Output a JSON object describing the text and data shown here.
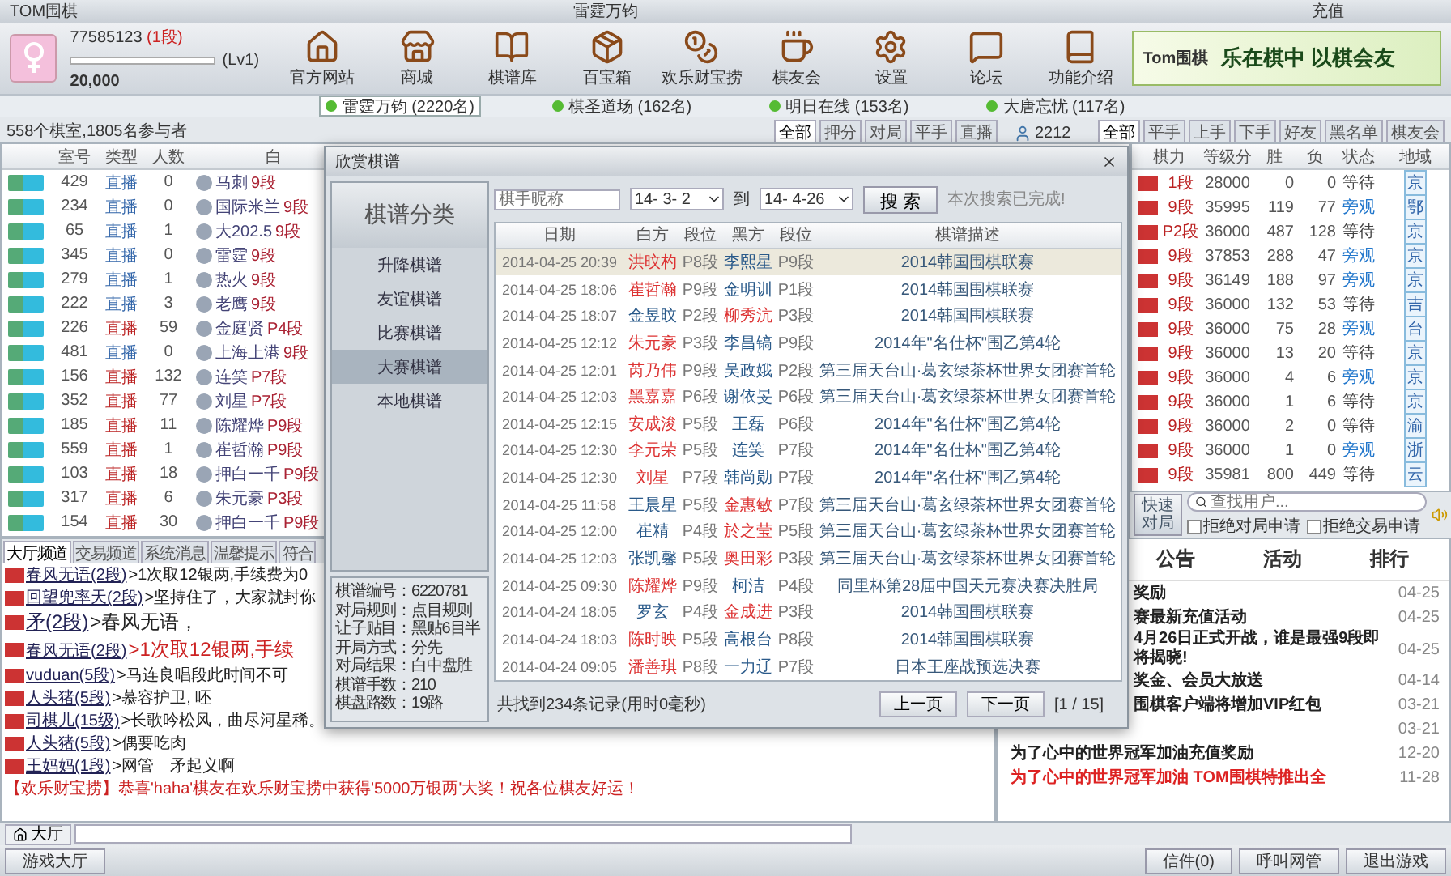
{
  "window": {
    "title": "TOM围棋",
    "server_title": "雷霆万钧",
    "recharge": "充值"
  },
  "user": {
    "id": "77585123",
    "rank": "(1段)",
    "level_label": "(Lv1)",
    "coins": "20,000",
    "level": 0.0
  },
  "toolbar": [
    "官方网站",
    "商城",
    "棋谱库",
    "百宝箱",
    "欢乐财宝捞",
    "棋友会",
    "设置",
    "论坛",
    "功能介绍"
  ],
  "banner": {
    "text": "乐在棋中 以棋会友",
    "logo": "Tom围棋"
  },
  "servers": [
    {
      "label": "雷霆万钧 (2220名)",
      "selected": true
    },
    {
      "label": "棋圣道场 (162名)",
      "selected": false
    },
    {
      "label": "明日在线 (153名)",
      "selected": false
    },
    {
      "label": "大唐忘忧 (117名)",
      "selected": false
    }
  ],
  "rooms_summary": "558个棋室,1805名参与者",
  "room_filters": [
    {
      "label": "全部",
      "selected": true
    },
    {
      "label": "押分",
      "selected": false
    },
    {
      "label": "对局",
      "selected": false
    },
    {
      "label": "平手",
      "selected": false
    },
    {
      "label": "直播",
      "selected": false
    }
  ],
  "online_count": "2212",
  "player_filters": [
    {
      "label": "全部",
      "selected": true
    },
    {
      "label": "平手",
      "selected": false
    },
    {
      "label": "上手",
      "selected": false
    },
    {
      "label": "下手",
      "selected": false
    },
    {
      "label": "好友",
      "selected": false
    },
    {
      "label": "黑名单",
      "selected": false
    },
    {
      "label": "棋友会",
      "selected": false
    }
  ],
  "rooms": {
    "columns": [
      "室号",
      "类型",
      "人数",
      "白"
    ],
    "rows": [
      {
        "room": "429",
        "type": "直播",
        "count": "0",
        "white": "马刺",
        "rank": "9段",
        "hot": false
      },
      {
        "room": "234",
        "type": "直播",
        "count": "0",
        "white": "国际米兰",
        "rank": "9段",
        "hot": false
      },
      {
        "room": "65",
        "type": "直播",
        "count": "1",
        "white": "大202.5",
        "rank": "9段",
        "hot": false
      },
      {
        "room": "345",
        "type": "直播",
        "count": "0",
        "white": "雷霆",
        "rank": "9段",
        "hot": false
      },
      {
        "room": "279",
        "type": "直播",
        "count": "1",
        "white": "热火",
        "rank": "9段",
        "hot": false
      },
      {
        "room": "222",
        "type": "直播",
        "count": "3",
        "white": "老鹰",
        "rank": "9段",
        "hot": false
      },
      {
        "room": "226",
        "type": "直播",
        "count": "59",
        "white": "金庭贤",
        "rank": "P4段",
        "hot": true
      },
      {
        "room": "481",
        "type": "直播",
        "count": "0",
        "white": "上海上港",
        "rank": "9段",
        "hot": false
      },
      {
        "room": "156",
        "type": "直播",
        "count": "132",
        "white": "连笑",
        "rank": "P7段",
        "hot": true
      },
      {
        "room": "352",
        "type": "直播",
        "count": "77",
        "white": "刘星",
        "rank": "P7段",
        "hot": true
      },
      {
        "room": "185",
        "type": "直播",
        "count": "11",
        "white": "陈耀烨",
        "rank": "P9段",
        "hot": true
      },
      {
        "room": "559",
        "type": "直播",
        "count": "1",
        "white": "崔哲瀚",
        "rank": "P9段",
        "hot": true
      },
      {
        "room": "103",
        "type": "直播",
        "count": "18",
        "white": "押白一千",
        "rank": "P9段",
        "hot": true
      },
      {
        "room": "317",
        "type": "直播",
        "count": "6",
        "white": "朱元豪",
        "rank": "P3段",
        "hot": true
      },
      {
        "room": "154",
        "type": "直播",
        "count": "30",
        "white": "押白一千",
        "rank": "P9段",
        "hot": true
      }
    ]
  },
  "players": {
    "columns": [
      "棋力",
      "等级分",
      "胜",
      "负",
      "状态",
      "地域"
    ],
    "rows": [
      {
        "rank": "1段",
        "score": "28000",
        "wins": "0",
        "losses": "0",
        "status": "等待",
        "watching": false,
        "region": "京"
      },
      {
        "rank": "9段",
        "score": "35995",
        "wins": "119",
        "losses": "77",
        "status": "旁观",
        "watching": true,
        "region": "鄂"
      },
      {
        "rank": "P2段",
        "score": "36000",
        "wins": "487",
        "losses": "128",
        "status": "等待",
        "watching": false,
        "region": "京"
      },
      {
        "rank": "9段",
        "score": "37853",
        "wins": "288",
        "losses": "47",
        "status": "旁观",
        "watching": true,
        "region": "京"
      },
      {
        "rank": "9段",
        "score": "36149",
        "wins": "188",
        "losses": "97",
        "status": "旁观",
        "watching": true,
        "region": "京"
      },
      {
        "rank": "9段",
        "score": "36000",
        "wins": "132",
        "losses": "53",
        "status": "等待",
        "watching": false,
        "region": "吉"
      },
      {
        "rank": "9段",
        "score": "36000",
        "wins": "75",
        "losses": "28",
        "status": "旁观",
        "watching": true,
        "region": "台"
      },
      {
        "rank": "9段",
        "score": "36000",
        "wins": "13",
        "losses": "20",
        "status": "等待",
        "watching": false,
        "region": "京"
      },
      {
        "rank": "9段",
        "score": "36000",
        "wins": "4",
        "losses": "6",
        "status": "旁观",
        "watching": true,
        "region": "京"
      },
      {
        "rank": "9段",
        "score": "36000",
        "wins": "1",
        "losses": "6",
        "status": "等待",
        "watching": false,
        "region": "京"
      },
      {
        "rank": "9段",
        "score": "36000",
        "wins": "2",
        "losses": "0",
        "status": "等待",
        "watching": false,
        "region": "渝"
      },
      {
        "rank": "9段",
        "score": "36000",
        "wins": "1",
        "losses": "0",
        "status": "旁观",
        "watching": true,
        "region": "浙"
      },
      {
        "rank": "9段",
        "score": "35981",
        "wins": "800",
        "losses": "449",
        "status": "等待",
        "watching": false,
        "region": "云"
      }
    ]
  },
  "quick_match": "快速对局",
  "user_search": {
    "placeholder": "查找用户..."
  },
  "options": [
    {
      "label": "拒绝对局申请",
      "checked": false
    },
    {
      "label": "拒绝交易申请",
      "checked": false
    }
  ],
  "chat_tabs": [
    {
      "label": "大厅频道",
      "selected": true
    },
    {
      "label": "交易频道",
      "selected": false
    },
    {
      "label": "系统消息",
      "selected": false
    },
    {
      "label": "温馨提示",
      "selected": false
    },
    {
      "label": "符合",
      "selected": false
    }
  ],
  "messages": [
    {
      "kind": "normal",
      "sender": "春风无语(2段)",
      "text": ">1次取12银两,手续费为0"
    },
    {
      "kind": "normal",
      "sender": "回望兜率天(2段)",
      "text": ">坚持住了，大家就封你"
    },
    {
      "kind": "big",
      "sender": "矛(2段)",
      "text": ">春风无语，"
    },
    {
      "kind": "bigred",
      "sender": "春风无语(2段)",
      "text": ">1次取12银两,手续"
    },
    {
      "kind": "normal",
      "sender": "vuduan(5段)",
      "text": ">马连良唱段此时间不可"
    },
    {
      "kind": "normal",
      "sender": "人头猪(5段)",
      "text": ">慕容护卫, 呸"
    },
    {
      "kind": "normal",
      "sender": "司棋儿(15级)",
      "text": ">长歌吟松风，曲尽河星稀。"
    },
    {
      "kind": "normal",
      "sender": "人头猪(5段)",
      "text": ">偶要吃肉"
    },
    {
      "kind": "normal",
      "sender": "王妈妈(1段)",
      "text": ">网管　矛起义啊"
    },
    {
      "kind": "system",
      "text": "【欢乐财宝捞】恭喜'haha'棋友在欢乐财宝捞中获得'5000万银两'大奖！祝各位棋友好运！"
    }
  ],
  "news_tabs": [
    {
      "label": "公告",
      "selected": false
    },
    {
      "label": "活动",
      "selected": false
    },
    {
      "label": "排行",
      "selected": false
    }
  ],
  "news": [
    {
      "title": "奖励",
      "date": "04-25",
      "highlight": false,
      "covered": true
    },
    {
      "title": "赛最新充值活动",
      "date": "04-25",
      "highlight": false,
      "covered": true
    },
    {
      "title": "4月26日正式开战，谁是最强9段即将揭晓!",
      "date": "04-25",
      "highlight": false,
      "covered": true
    },
    {
      "title": "奖金、会员大放送",
      "date": "04-14",
      "highlight": false,
      "covered": true
    },
    {
      "title": "围棋客户端将增加VIP红包",
      "date": "03-21",
      "highlight": false,
      "covered": true
    },
    {
      "date": "03-21"
    },
    {
      "title": "为了心中的世界冠军加油充值奖励",
      "date": "12-20",
      "highlight": false,
      "covered": false
    },
    {
      "title": "为了心中的世界冠军加油  TOM围棋特推出全",
      "date": "11-28",
      "highlight": true,
      "covered": false
    }
  ],
  "chat_input": {
    "channel": "大厅"
  },
  "status_bar": {
    "tab": "游戏大厅",
    "buttons": [
      "信件(0)",
      "呼叫网管",
      "退出游戏"
    ]
  },
  "dialog": {
    "title": "欣赏棋谱",
    "category_title": "棋谱分类",
    "categories": [
      {
        "label": "升降棋谱",
        "selected": false
      },
      {
        "label": "友谊棋谱",
        "selected": false
      },
      {
        "label": "比赛棋谱",
        "selected": false
      },
      {
        "label": "大赛棋谱",
        "selected": true
      },
      {
        "label": "本地棋谱",
        "selected": false
      }
    ],
    "info": [
      "棋谱编号：6220781",
      "对局规则：点目规则",
      "让子贴目：黑贴6目半",
      "开局方式：分先",
      "对局结果：白中盘胜",
      "棋谱手数：210",
      "棋盘路数：19路"
    ],
    "search": {
      "placeholder": "棋手昵称",
      "from": "14- 3- 2",
      "to_label": "到",
      "to": "14- 4-26",
      "button": "搜 索",
      "status": "本次搜索已完成!"
    },
    "columns": [
      "日期",
      "白方",
      "段位",
      "黑方",
      "段位",
      "棋谱描述"
    ],
    "rows": [
      {
        "date": "2014-04-25 20:39",
        "white": "洪旼杓",
        "wrank": "P8段",
        "black": "李熙星",
        "brank": "P9段",
        "desc": "2014韩国围棋联赛",
        "white_won": true,
        "selected": true
      },
      {
        "date": "2014-04-25 18:06",
        "white": "崔哲瀚",
        "wrank": "P9段",
        "black": "金明训",
        "brank": "P1段",
        "desc": "2014韩国围棋联赛",
        "white_won": true,
        "selected": false
      },
      {
        "date": "2014-04-25 18:07",
        "white": "金昱旼",
        "wrank": "P2段",
        "black": "柳秀沆",
        "brank": "P3段",
        "desc": "2014韩国围棋联赛",
        "white_won": false,
        "selected": false
      },
      {
        "date": "2014-04-25 12:12",
        "white": "朱元豪",
        "wrank": "P3段",
        "black": "李昌镐",
        "brank": "P9段",
        "desc": "2014年\"名仕杯\"围乙第4轮",
        "white_won": true,
        "selected": false
      },
      {
        "date": "2014-04-25 12:01",
        "white": "芮乃伟",
        "wrank": "P9段",
        "black": "吴政娥",
        "brank": "P2段",
        "desc": "第三届天台山·葛玄绿茶杯世界女团赛首轮",
        "white_won": true,
        "selected": false
      },
      {
        "date": "2014-04-25 12:03",
        "white": "黑嘉嘉",
        "wrank": "P6段",
        "black": "谢依旻",
        "brank": "P6段",
        "desc": "第三届天台山·葛玄绿茶杯世界女团赛首轮",
        "white_won": true,
        "selected": false
      },
      {
        "date": "2014-04-25 12:15",
        "white": "安成浚",
        "wrank": "P5段",
        "black": "王磊",
        "brank": "P6段",
        "desc": "2014年\"名仕杯\"围乙第4轮",
        "white_won": true,
        "selected": false
      },
      {
        "date": "2014-04-25 12:30",
        "white": "李元荣",
        "wrank": "P5段",
        "black": "连笑",
        "brank": "P7段",
        "desc": "2014年\"名仕杯\"围乙第4轮",
        "white_won": true,
        "selected": false
      },
      {
        "date": "2014-04-25 12:30",
        "white": "刘星",
        "wrank": "P7段",
        "black": "韩尚勋",
        "brank": "P7段",
        "desc": "2014年\"名仕杯\"围乙第4轮",
        "white_won": true,
        "selected": false
      },
      {
        "date": "2014-04-25 11:58",
        "white": "王晨星",
        "wrank": "P5段",
        "black": "金惠敏",
        "brank": "P7段",
        "desc": "第三届天台山·葛玄绿茶杯世界女团赛首轮",
        "white_won": false,
        "selected": false
      },
      {
        "date": "2014-04-25 12:00",
        "white": "崔精",
        "wrank": "P4段",
        "black": "於之莹",
        "brank": "P5段",
        "desc": "第三届天台山·葛玄绿茶杯世界女团赛首轮",
        "white_won": false,
        "selected": false
      },
      {
        "date": "2014-04-25 12:03",
        "white": "张凯馨",
        "wrank": "P5段",
        "black": "奥田彩",
        "brank": "P3段",
        "desc": "第三届天台山·葛玄绿茶杯世界女团赛首轮",
        "white_won": false,
        "selected": false
      },
      {
        "date": "2014-04-25 09:30",
        "white": "陈耀烨",
        "wrank": "P9段",
        "black": "柯洁",
        "brank": "P4段",
        "desc": "同里杯第28届中国天元赛决赛决胜局",
        "white_won": true,
        "selected": false
      },
      {
        "date": "2014-04-24 18:05",
        "white": "罗玄",
        "wrank": "P4段",
        "black": "金成进",
        "brank": "P3段",
        "desc": "2014韩国围棋联赛",
        "white_won": false,
        "selected": false
      },
      {
        "date": "2014-04-24 18:03",
        "white": "陈时映",
        "wrank": "P5段",
        "black": "高根台",
        "brank": "P8段",
        "desc": "2014韩国围棋联赛",
        "white_won": true,
        "selected": false
      },
      {
        "date": "2014-04-24 09:05",
        "white": "潘善琪",
        "wrank": "P8段",
        "black": "一力辽",
        "brank": "P7段",
        "desc": "日本王座战预选决赛",
        "white_won": true,
        "selected": false
      }
    ],
    "summary": "共找到234条记录(用时0毫秒)",
    "prev": "上一页",
    "next": "下一页",
    "page": "[1 / 15]"
  }
}
